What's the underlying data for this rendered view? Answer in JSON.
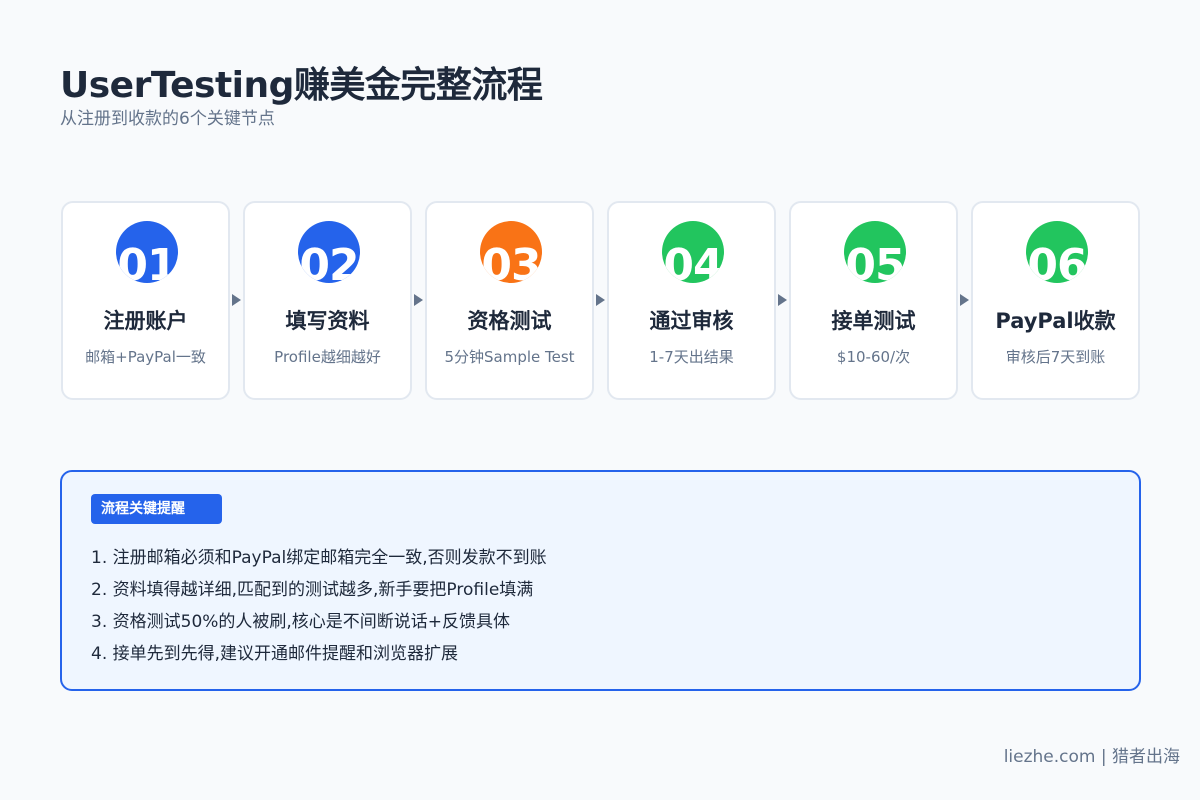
{
  "header": {
    "title": "UserTesting赚美金完整流程",
    "subtitle": "从注册到收款的6个关键节点"
  },
  "colors": {
    "blue": "#2563eb",
    "orange": "#f97316",
    "green": "#22c55e"
  },
  "steps": [
    {
      "num": "01",
      "title": "注册账户",
      "desc": "邮箱+PayPal一致",
      "color": "#2563eb"
    },
    {
      "num": "02",
      "title": "填写资料",
      "desc": "Profile越细越好",
      "color": "#2563eb"
    },
    {
      "num": "03",
      "title": "资格测试",
      "desc": "5分钟Sample Test",
      "color": "#f97316"
    },
    {
      "num": "04",
      "title": "通过审核",
      "desc": "1-7天出结果",
      "color": "#22c55e"
    },
    {
      "num": "05",
      "title": "接单测试",
      "desc": "$10-60/次",
      "color": "#22c55e"
    },
    {
      "num": "06",
      "title": "PayPal收款",
      "desc": "审核后7天到账",
      "color": "#22c55e"
    }
  ],
  "notes": {
    "tag": "流程关键提醒",
    "items": [
      "1. 注册邮箱必须和PayPal绑定邮箱完全一致,否则发款不到账",
      "2. 资料填得越详细,匹配到的测试越多,新手要把Profile填满",
      "3. 资格测试50%的人被刷,核心是不间断说话+反馈具体",
      "4. 接单先到先得,建议开通邮件提醒和浏览器扩展"
    ]
  },
  "footer": {
    "text": "liezhe.com | 猎者出海"
  }
}
